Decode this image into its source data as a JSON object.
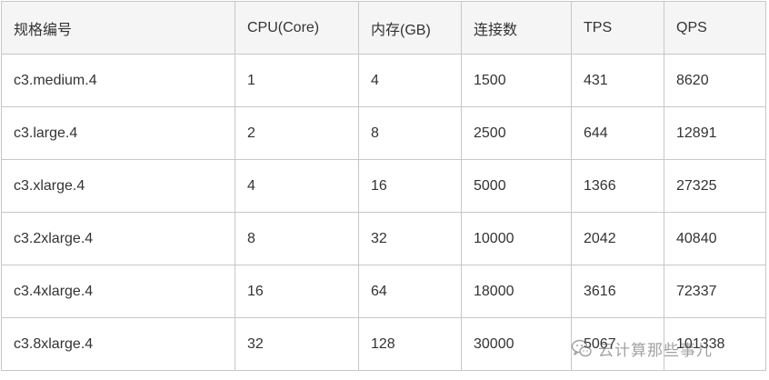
{
  "table": {
    "headers": [
      "规格编号",
      "CPU(Core)",
      "内存(GB)",
      "连接数",
      "TPS",
      "QPS"
    ],
    "rows": [
      [
        "c3.medium.4",
        "1",
        "4",
        "1500",
        "431",
        "8620"
      ],
      [
        "c3.large.4",
        "2",
        "8",
        "2500",
        "644",
        "12891"
      ],
      [
        "c3.xlarge.4",
        "4",
        "16",
        "5000",
        "1366",
        "27325"
      ],
      [
        "c3.2xlarge.4",
        "8",
        "32",
        "10000",
        "2042",
        "40840"
      ],
      [
        "c3.4xlarge.4",
        "16",
        "64",
        "18000",
        "3616",
        "72337"
      ],
      [
        "c3.8xlarge.4",
        "32",
        "128",
        "30000",
        "5067",
        "101338"
      ]
    ]
  },
  "watermark": {
    "text": "云计算那些事儿",
    "icon": "wechat-icon"
  }
}
